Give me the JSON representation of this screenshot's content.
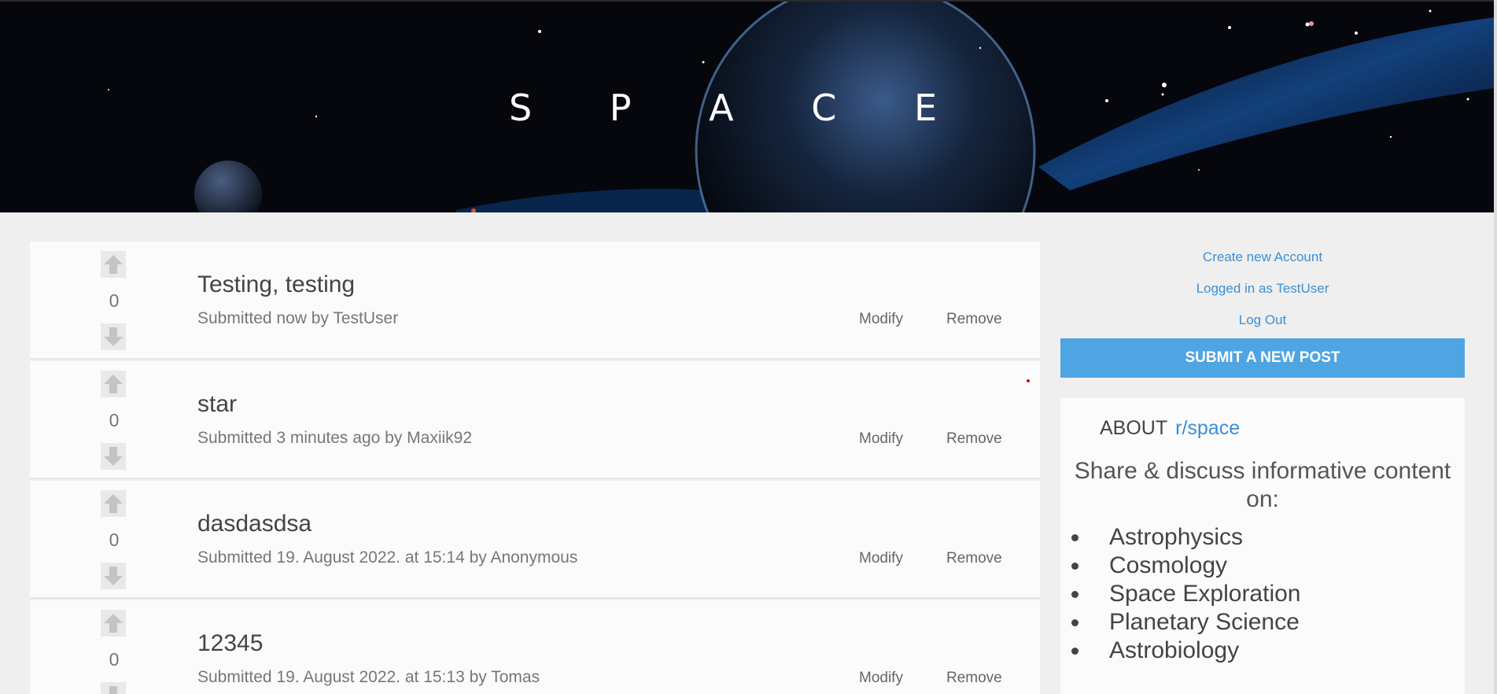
{
  "banner": {
    "title": "S P A C E"
  },
  "posts": [
    {
      "title": "Testing, testing",
      "meta": "Submitted now by TestUser",
      "score": "0",
      "modify": "Modify",
      "remove": "Remove"
    },
    {
      "title": "star",
      "meta": "Submitted 3 minutes ago by Maxiik92",
      "score": "0",
      "modify": "Modify",
      "remove": "Remove"
    },
    {
      "title": "dasdasdsa",
      "meta": "Submitted 19. August 2022. at 15:14 by Anonymous",
      "score": "0",
      "modify": "Modify",
      "remove": "Remove"
    },
    {
      "title": "12345",
      "meta": "Submitted 19. August 2022. at 15:13 by Tomas",
      "score": "0",
      "modify": "Modify",
      "remove": "Remove"
    }
  ],
  "sidebar": {
    "create_account": "Create new Account",
    "logged_in": "Logged in as TestUser",
    "log_out": "Log Out",
    "submit_label": "SUBMIT A NEW POST",
    "about_label": "ABOUT",
    "subreddit": "r/space",
    "description": "Share & discuss informative content on:",
    "topics": [
      "Astrophysics",
      "Cosmology",
      "Space Exploration",
      "Planetary Science",
      "Astrobiology"
    ]
  },
  "colors": {
    "accent": "#4fa4e2",
    "link": "#3b8fd6",
    "background": "#efefef",
    "card": "#fbfbfb"
  },
  "icons": {
    "up": "arrow-up-icon",
    "down": "arrow-down-icon"
  }
}
